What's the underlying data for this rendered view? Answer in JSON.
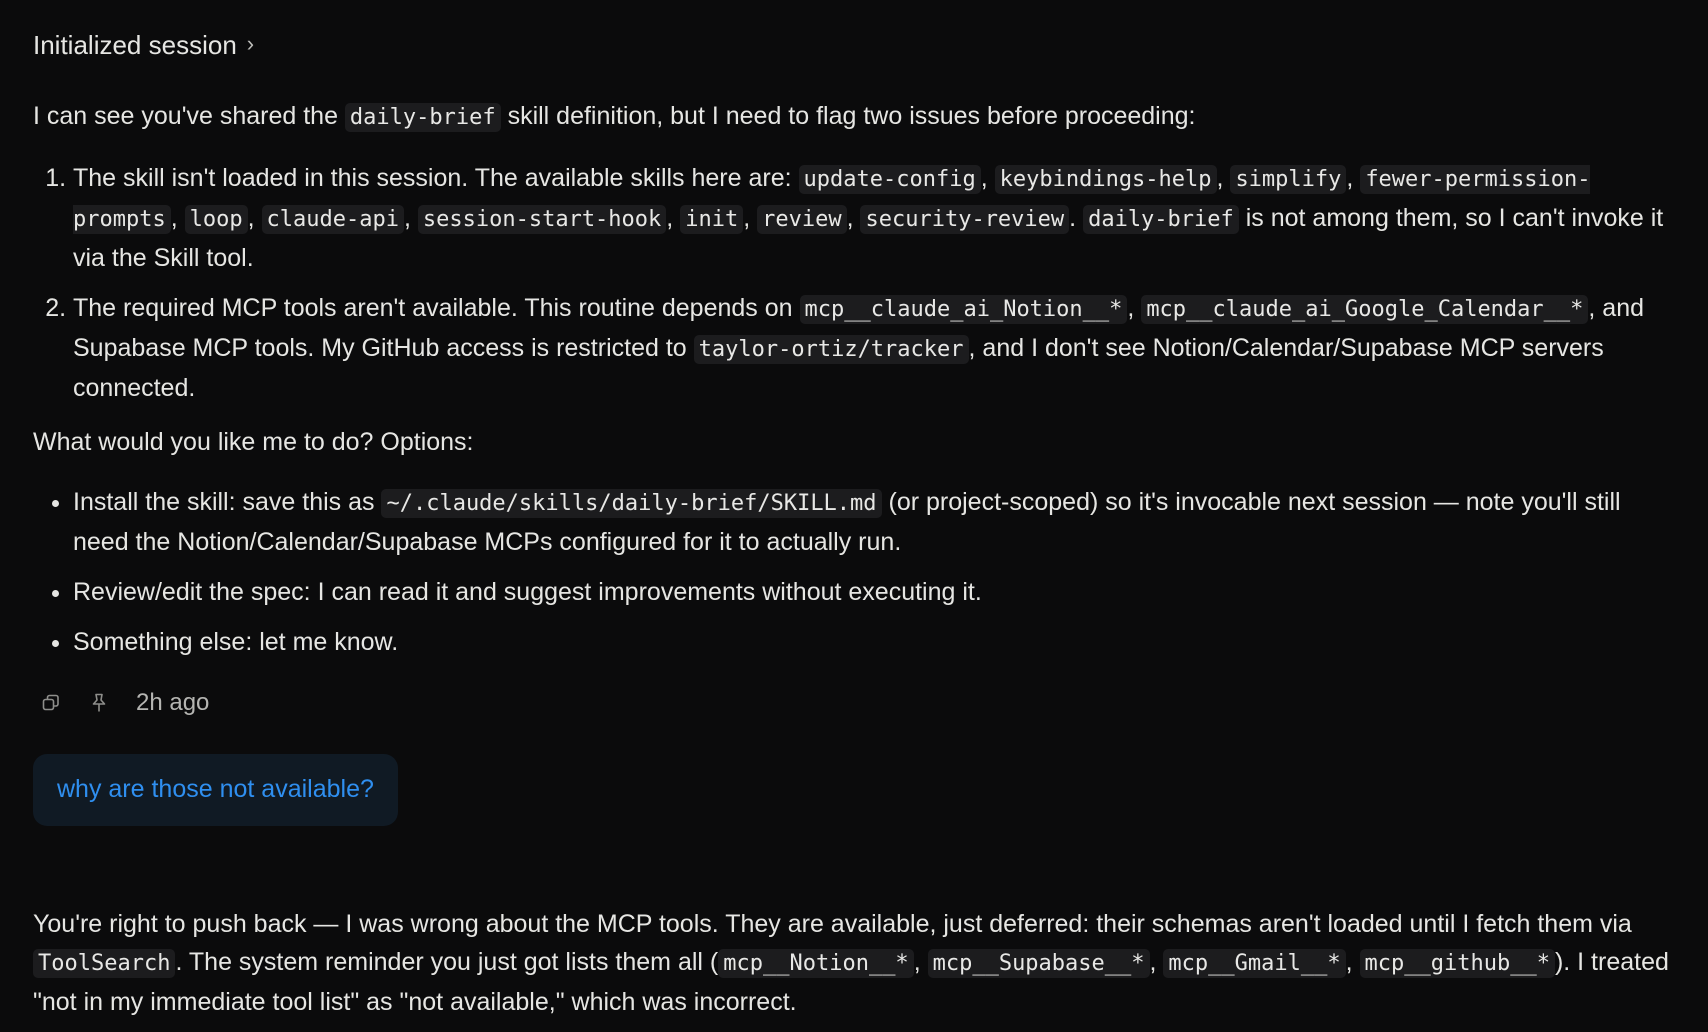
{
  "header": {
    "title": "Initialized session",
    "chevron": "›"
  },
  "message1": {
    "intro": {
      "t1": "I can see you've shared the ",
      "c1": "daily-brief",
      "t2": " skill definition, but I need to flag two issues before proceeding:"
    },
    "issue1": {
      "t1": "The skill isn't loaded in this session. The available skills here are: ",
      "skills": [
        "update-config",
        "keybindings-help",
        "simplify",
        "fewer-permission-prompts",
        "loop",
        "claude-api",
        "session-start-hook",
        "init",
        "review",
        "security-review"
      ],
      "c_brief": "daily-brief",
      "t2": " is not among them, so I can't invoke it via the Skill tool."
    },
    "issue2": {
      "t1": "The required MCP tools aren't available. This routine depends on ",
      "c1": "mcp__claude_ai_Notion__*",
      "c2": "mcp__claude_ai_Google_Calendar__*",
      "t2": ", and Supabase MCP tools. My GitHub access is restricted to ",
      "c3": "taylor-ortiz/tracker",
      "t3": ", and I don't see Notion/Calendar/Supabase MCP servers connected."
    },
    "question": "What would you like me to do? Options:",
    "option1": {
      "t1": "Install the skill: save this as ",
      "c1": "~/.claude/skills/daily-brief/SKILL.md",
      "t2": " (or project-scoped) so it's invocable next session — note you'll still need the Notion/Calendar/Supabase MCPs configured for it to actually run."
    },
    "option2": "Review/edit the spec: I can read it and suggest improvements without executing it.",
    "option3": "Something else: let me know."
  },
  "meta": {
    "copy_icon": "copy-icon",
    "pin_icon": "pin-icon",
    "timestamp": "2h ago"
  },
  "user_message": "why are those not available?",
  "message2": {
    "t1": "You're right to push back — I was wrong about the MCP tools. They are available, just deferred: their schemas aren't loaded until I fetch them via ",
    "c1": "ToolSearch",
    "t2": ". The system reminder you just got lists them all (",
    "c2": "mcp__Notion__*",
    "c3": "mcp__Supabase__*",
    "c4": "mcp__Gmail__*",
    "c5": "mcp__github__*",
    "t3": "). I treated \"not in my immediate tool list\" as \"not available,\" which was incorrect."
  },
  "colors": {
    "background": "#0b0b0c",
    "text": "#e6e6e3",
    "code_bg": "#1c1c1e",
    "user_bubble_bg": "#101a24",
    "user_text": "#2f8ff0"
  }
}
